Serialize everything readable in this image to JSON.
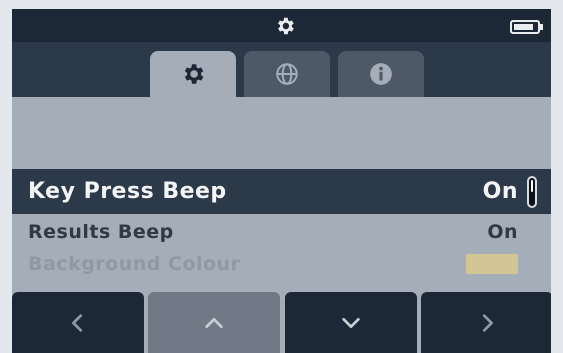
{
  "header": {
    "title_icon": "gear-icon",
    "battery_icon": "battery-icon"
  },
  "tabs": [
    {
      "icon": "gear-icon",
      "active": true
    },
    {
      "icon": "globe-icon",
      "active": false
    },
    {
      "icon": "info-icon",
      "active": false
    }
  ],
  "settings": {
    "items": [
      {
        "label": "Key Press Beep",
        "value": "On",
        "selected": true
      },
      {
        "label": "Results Beep",
        "value": "On",
        "selected": false
      },
      {
        "label": "Background Colour",
        "value": "",
        "swatch_color": "#d6c98f",
        "selected": false
      }
    ]
  },
  "nav": [
    {
      "icon": "chevron-left-icon"
    },
    {
      "icon": "chevron-up-icon"
    },
    {
      "icon": "chevron-down-icon"
    },
    {
      "icon": "chevron-right-icon"
    }
  ],
  "colors": {
    "topbar": "#1c2836",
    "panel": "#a4adb8",
    "selected_row": "#2c3948",
    "nav_dark": "#1c2836",
    "nav_light": "#6f7a86"
  }
}
